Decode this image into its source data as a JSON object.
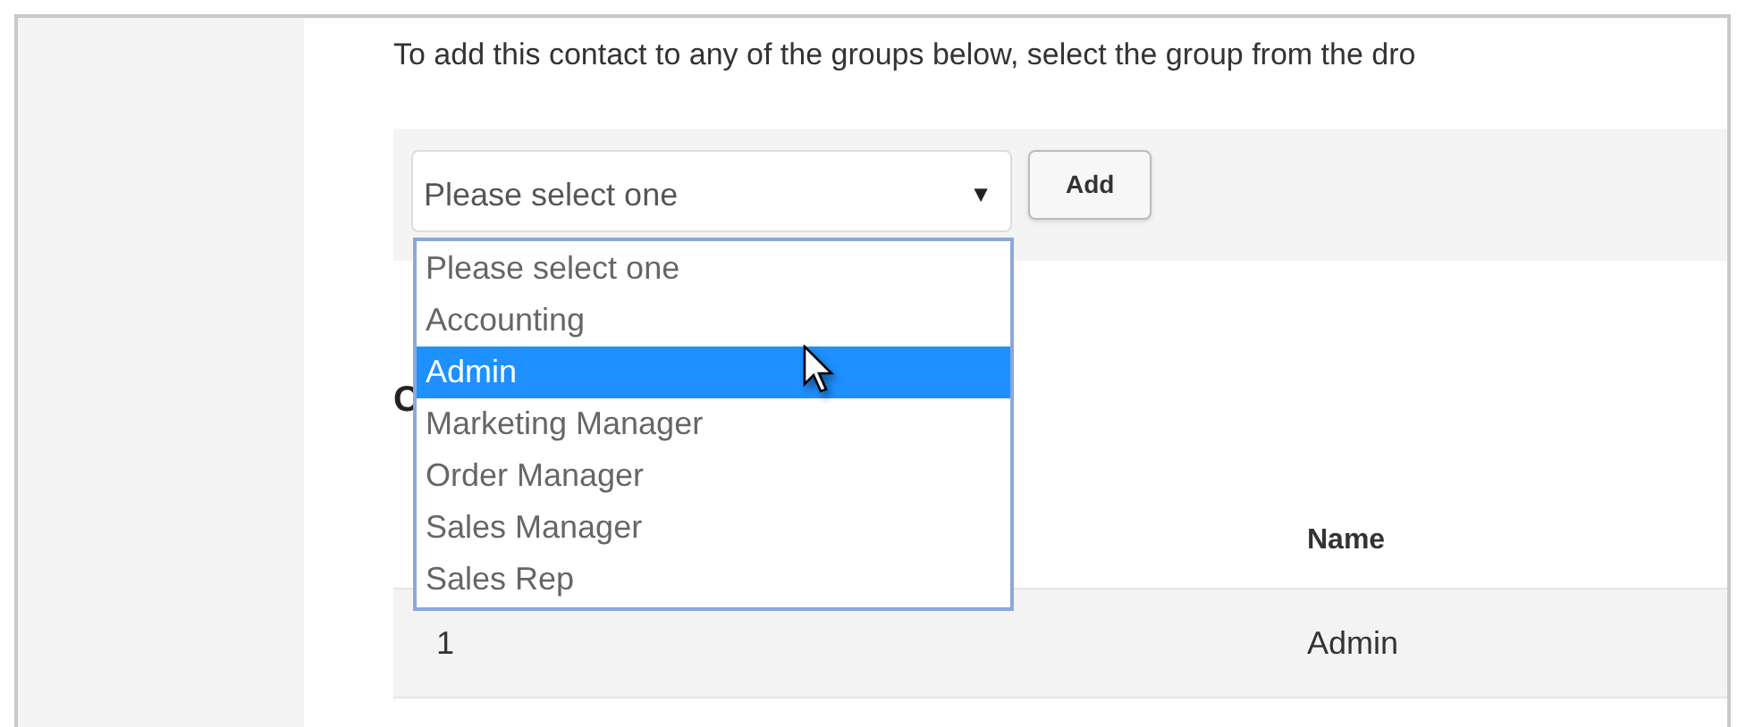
{
  "instructions": "To add this contact to any of the groups below, select the group from the dro",
  "group_select": {
    "value": "Please select one",
    "caret": "▼",
    "expanded": true,
    "options": [
      {
        "label": "Please select one",
        "highlighted": false
      },
      {
        "label": "Accounting",
        "highlighted": false
      },
      {
        "label": "Admin",
        "highlighted": true
      },
      {
        "label": "Marketing Manager",
        "highlighted": false
      },
      {
        "label": "Order Manager",
        "highlighted": false
      },
      {
        "label": "Sales Manager",
        "highlighted": false
      },
      {
        "label": "Sales Rep",
        "highlighted": false
      }
    ]
  },
  "add_button": "Add",
  "section_heading": "C",
  "table": {
    "columns": [
      "",
      "Name"
    ],
    "rows": [
      [
        "1",
        "Admin"
      ]
    ]
  }
}
